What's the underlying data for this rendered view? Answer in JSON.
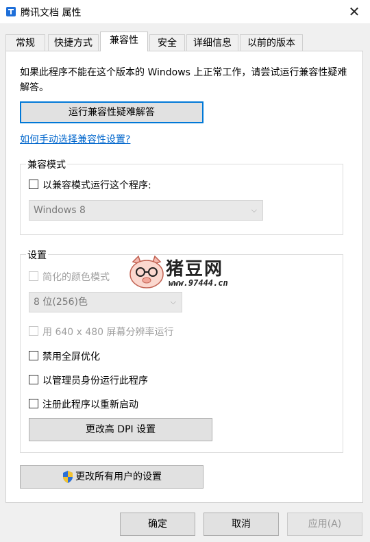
{
  "window": {
    "title": "腾讯文档 属性",
    "close_glyph": "✕"
  },
  "tabs": [
    {
      "label": "常规",
      "active": false
    },
    {
      "label": "快捷方式",
      "active": false
    },
    {
      "label": "兼容性",
      "active": true
    },
    {
      "label": "安全",
      "active": false
    },
    {
      "label": "详细信息",
      "active": false
    },
    {
      "label": "以前的版本",
      "active": false
    }
  ],
  "compat": {
    "intro": "如果此程序不能在这个版本的 Windows 上正常工作，请尝试运行兼容性疑难解答。",
    "troubleshoot_button": "运行兼容性疑难解答",
    "manual_link": "如何手动选择兼容性设置?"
  },
  "compat_mode": {
    "group_label": "兼容模式",
    "checkbox_label": "以兼容模式运行这个程序:",
    "select_value": "Windows 8"
  },
  "settings": {
    "group_label": "设置",
    "reduced_color_label": "简化的颜色模式",
    "color_select_value": "8 位(256)色",
    "res_640_label": "用 640 x 480 屏幕分辨率运行",
    "disable_fullscreen_label": "禁用全屏优化",
    "run_as_admin_label": "以管理员身份运行此程序",
    "register_restart_label": "注册此程序以重新启动",
    "dpi_button": "更改高 DPI 设置"
  },
  "all_users_button": "更改所有用户的设置",
  "footer": {
    "ok": "确定",
    "cancel": "取消",
    "apply": "应用(A)"
  },
  "watermark": {
    "name": "猪豆网",
    "url": "www.97444.cn"
  },
  "colors": {
    "accent": "#0078d7",
    "link": "#0066cc"
  }
}
